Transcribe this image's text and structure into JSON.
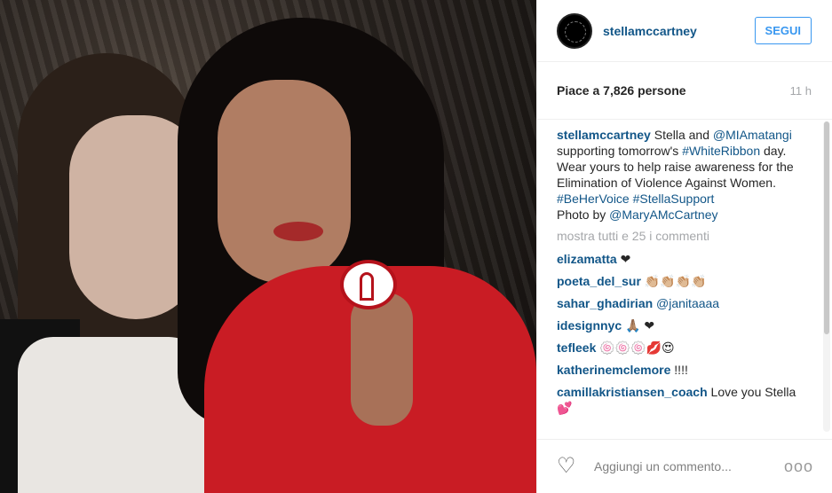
{
  "post": {
    "username": "stellamccartney",
    "follow_label": "SEGUI",
    "likes": "Piace a 7,826 persone",
    "time": "11 h",
    "caption": {
      "user": "stellamccartney",
      "t1": " Stella and ",
      "mention1": "@MIAmatangi",
      "t2": " supporting tomorrow's ",
      "tag1": "#WhiteRibbon",
      "t3": " day. Wear yours to help raise awareness for the Elimination of Violence Against Women.",
      "tag2": "#BeHerVoice",
      "tag3": "#StellaSupport",
      "t4": "Photo by ",
      "mention2": "@MaryAMcCartney"
    },
    "view_all": "mostra tutti e 25 i commenti",
    "comments": [
      {
        "user": "elizamatta",
        "text": " ❤"
      },
      {
        "user": "poeta_del_sur",
        "text": " 👏🏼👏🏼👏🏼👏🏼"
      },
      {
        "user": "sahar_ghadirian",
        "text": " @janitaaaa"
      },
      {
        "user": "idesignnyc",
        "text": " 🙏🏽     ❤"
      },
      {
        "user": "tefleek",
        "text": " 🍥🍥🍥💋😍"
      },
      {
        "user": "katherinemclemore",
        "text": " !!!!"
      },
      {
        "user": "camillakristiansen_coach",
        "text": " Love you Stella💕"
      }
    ],
    "comment_placeholder": "Aggiungi un commento...",
    "more_label": "ooo"
  },
  "icons": {
    "heart": "heart-outline-icon",
    "more": "more-options-icon"
  },
  "colors": {
    "link": "#125688",
    "follow": "#3897f0",
    "muted": "#a5a7aa"
  }
}
